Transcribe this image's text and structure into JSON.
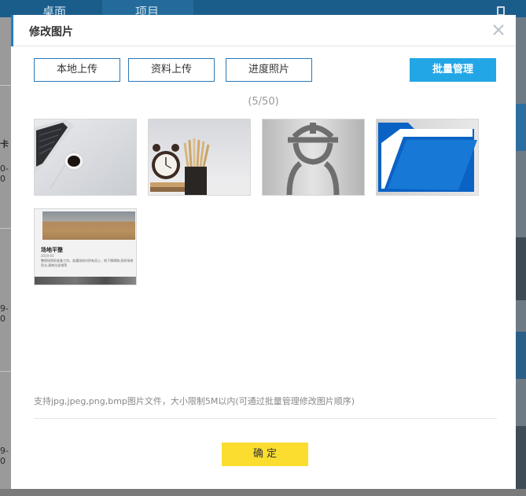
{
  "background": {
    "tabs": [
      "桌面",
      "项目"
    ],
    "left_fragments": [
      "卡",
      "0-0",
      "9-0",
      "9-0"
    ]
  },
  "modal": {
    "title": "修改图片",
    "buttons": {
      "local_upload": "本地上传",
      "data_upload": "资料上传",
      "progress_photo": "进度照片",
      "batch_manage": "批量管理",
      "confirm": "确 定"
    },
    "counter": "(5/50)",
    "images": [
      {
        "name": "laptop-coffee"
      },
      {
        "name": "clock-pencils"
      },
      {
        "name": "worker-avatar"
      },
      {
        "name": "folder"
      },
      {
        "name": "site-leveling-document"
      }
    ],
    "image5_card": {
      "title": "场地平整",
      "date": "2019-01",
      "text": "整理场院前准备工作。若遇场地内积有泥土、地下障碍物,拆除场地积水,建筑垃圾堆等"
    },
    "hint": "支持jpg,jpeg,png,bmp图片文件，大小限制5M以内(可通过批量管理修改图片顺序)"
  },
  "colors": {
    "accent": "#1f7ec8",
    "primary_button": "#23a6e6",
    "confirm_button": "#fadd2f"
  }
}
